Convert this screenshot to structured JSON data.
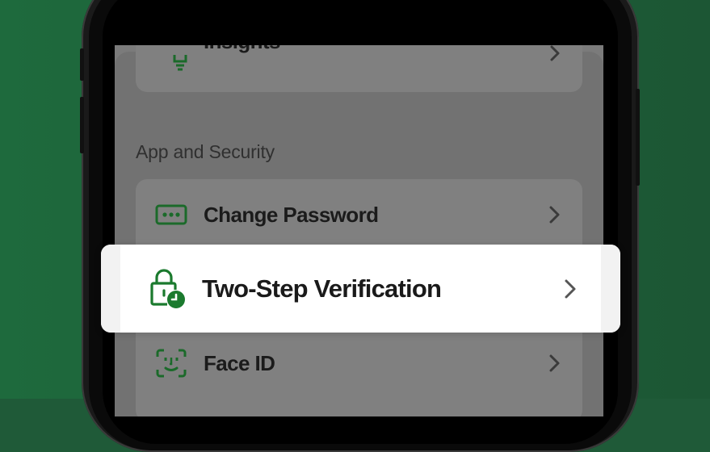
{
  "colors": {
    "brand_green": "#1b7a2e",
    "background": "#1f5a38"
  },
  "top_item": {
    "label": "Insights",
    "icon": "lightbulb-icon"
  },
  "section": {
    "title": "App and Security"
  },
  "rows": [
    {
      "label": "Change Password",
      "icon": "password-dots-icon"
    },
    {
      "label": "Two-Step Verification",
      "icon": "lock-clock-icon",
      "highlighted": true
    },
    {
      "label": "Face ID",
      "icon": "face-id-icon"
    }
  ]
}
